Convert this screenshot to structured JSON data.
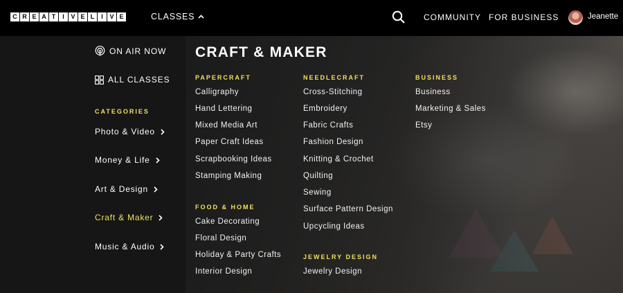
{
  "header": {
    "logo_text": "CREATIVELIVE",
    "classes_label": "CLASSES",
    "community_label": "COMMUNITY",
    "business_label": "FOR BUSINESS",
    "user_name": "Jeanette"
  },
  "sidebar": {
    "on_air_label": "ON AIR NOW",
    "all_classes_label": "ALL CLASSES",
    "categories_heading": "CATEGORIES",
    "categories": [
      "Photo & Video",
      "Money & Life",
      "Art & Design",
      "Craft & Maker",
      "Music & Audio"
    ],
    "active_category": "Craft & Maker"
  },
  "panel": {
    "title": "CRAFT & MAKER",
    "papercraft": {
      "heading": "PAPERCRAFT",
      "links": [
        "Calligraphy",
        "Hand Lettering",
        "Mixed Media Art",
        "Paper Craft Ideas",
        "Scrapbooking Ideas",
        "Stamping Making"
      ]
    },
    "food_home": {
      "heading": "FOOD & HOME",
      "links": [
        "Cake Decorating",
        "Floral Design",
        "Holiday & Party Crafts",
        "Interior Design"
      ]
    },
    "needlecraft": {
      "heading": "NEEDLECRAFT",
      "links": [
        "Cross-Stitching",
        "Embroidery",
        "Fabric Crafts",
        "Fashion Design",
        "Knitting & Crochet",
        "Quilting",
        "Sewing",
        "Surface Pattern Design",
        "Upcycling Ideas"
      ]
    },
    "jewelry": {
      "heading": "JEWELRY DESIGN",
      "links": [
        "Jewelry Design"
      ]
    },
    "business": {
      "heading": "BUSINESS",
      "links": [
        "Business",
        "Marketing & Sales",
        "Etsy"
      ]
    }
  },
  "colors": {
    "accent": "#f0e25a",
    "topbar": "#000000",
    "sidebar": "#161616"
  }
}
